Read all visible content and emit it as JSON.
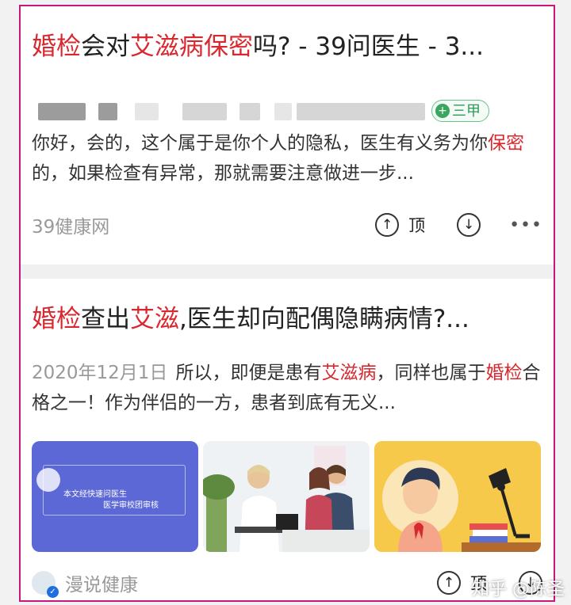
{
  "results": [
    {
      "title_parts": [
        {
          "text": "婚检",
          "hl": true
        },
        {
          "text": "会对",
          "hl": false
        },
        {
          "text": "艾滋病保密",
          "hl": true
        },
        {
          "text": "吗? - 39问医生 - 3...",
          "hl": false
        }
      ],
      "hospital_badge": "三甲",
      "snippet_parts": [
        {
          "text": "你好，会的，这个属于是你个人的隐私，医生有义务为你",
          "hl": false
        },
        {
          "text": "保密",
          "hl": true
        },
        {
          "text": "的，如果检查有异常，那就需要注意做进一步...",
          "hl": false
        }
      ],
      "source": "39健康网",
      "upvote_label": "顶"
    },
    {
      "title_parts": [
        {
          "text": "婚检",
          "hl": true
        },
        {
          "text": "查出",
          "hl": false
        },
        {
          "text": "艾滋",
          "hl": true
        },
        {
          "text": ",医生却向配偶隐瞒病情?...",
          "hl": false
        }
      ],
      "date": "2020年12月1日",
      "snippet_parts": [
        {
          "text": "所以，即便是患有",
          "hl": false
        },
        {
          "text": "艾滋病",
          "hl": true
        },
        {
          "text": "，同样也属于",
          "hl": false
        },
        {
          "text": "婚检",
          "hl": true
        },
        {
          "text": "合格之一！作为伴侣的一方，患者到底有无义...",
          "hl": false
        }
      ],
      "thumbnail_text": [
        "本文经快速问医生",
        "医学审校团审核"
      ],
      "source": "漫说健康",
      "upvote_label": "顶"
    }
  ],
  "watermark": "知乎 @陈圣",
  "colors": {
    "highlight": "#d9272e",
    "frame": "#c8167a",
    "badge": "#2e9a57"
  }
}
